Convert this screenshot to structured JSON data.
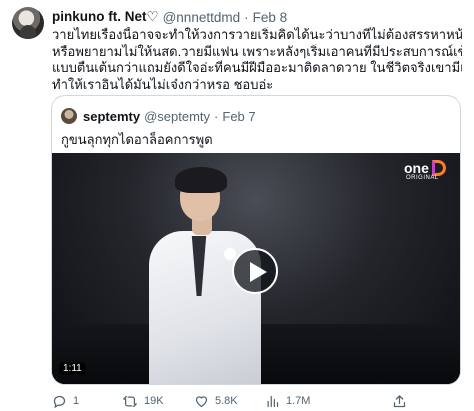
{
  "tweet": {
    "display_name": "pinkuno ft. Net♡",
    "handle": "@nnnettdmd",
    "separator": "·",
    "time": "Feb 8",
    "text_lines": [
      "วายไทยเรื่องนี้อาจจะทำให้วงการวายเริ่มคิดได้นะว่าบางทีไม่ต้องสรรหาหน้าใหม่มา",
      "หรือพยายามไม่ให้นสด.วายมีแฟน เพราะหลังๆเริ่มเอาคนที่มีประสบการณ์เข้าเล่นมัน",
      "แบบตื่นเต้นกว่าแถมยังดีใจอ่ะที่คนมีฝีมืออะมาติดลาดวาย ในชีวิตจริงเขามีแฟนแต่",
      "ทำให้เราอินได้มันไม่เจ๋งกว่าหรอ ชอบอ่ะ"
    ]
  },
  "quote": {
    "display_name": "septemty",
    "handle": "@septemty",
    "separator": "·",
    "time": "Feb 7",
    "text": "กูขนลุกทุกไดอาล็อคการพูด",
    "video": {
      "logo_text": "one",
      "logo_sub": "ORIGINAL",
      "duration": "1:11",
      "play_icon": "play-icon"
    }
  },
  "actions": {
    "reply_count": "1",
    "retweet_count": "19K",
    "like_count": "5.8K",
    "view_count": "1.7M"
  },
  "colors": {
    "text_primary": "#0f1419",
    "text_secondary": "#536471",
    "border": "#cfd9de"
  }
}
